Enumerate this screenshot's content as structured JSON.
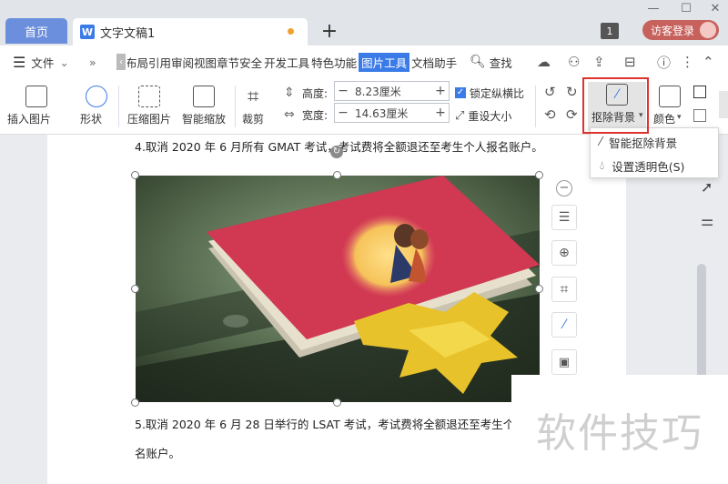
{
  "titlebar": {
    "home_tab": "首页",
    "doc_tab": "文字文稿1",
    "doc_icon": "W",
    "new_tab": "+",
    "count_badge": "1",
    "login_button": "访客登录"
  },
  "menubar": {
    "file": "文件",
    "tabs": [
      "布局",
      "引用",
      "审阅",
      "视图",
      "章节",
      "安全",
      "开发工具",
      "特色功能",
      "图片工具",
      "文档助手"
    ],
    "active_tab": "图片工具",
    "search": "查找"
  },
  "ribbon": {
    "insert_picture": "插入图片",
    "shape": "形状",
    "compress_picture": "压缩图片",
    "smart_zoom": "智能缩放",
    "crop": "裁剪",
    "height_label": "高度:",
    "height_value": "8.23厘米",
    "width_label": "宽度:",
    "width_value": "14.63厘米",
    "lock_ratio": "锁定纵横比",
    "reset_size": "重设大小",
    "remove_bg": "抠除背景",
    "color": "颜色"
  },
  "dropdown": {
    "smart_remove_bg": "智能抠除背景",
    "set_transparent": "设置透明色(S)"
  },
  "document": {
    "para1": "4.取消 2020 年 6 月所有 GMAT 考试，考试费将全额退还至考生个人报名账户。",
    "para2": "5.取消 2020 年 6 月 28 日举行的 LSAT 考试，考试费将全额退还至考生个",
    "para3": "名账户。"
  },
  "watermark": "软件技巧",
  "colors": {
    "accent": "#3b7be8",
    "highlight_box": "#e0322d",
    "login_button": "#c7615c"
  }
}
